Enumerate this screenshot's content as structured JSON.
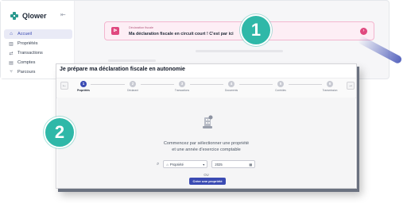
{
  "app": {
    "logo_text": "Qlower"
  },
  "sidebar": {
    "items": [
      {
        "label": "Accueil",
        "icon": "home-icon",
        "active": true
      },
      {
        "label": "Propriétés",
        "icon": "building-icon",
        "active": false
      },
      {
        "label": "Transactions",
        "icon": "transfer-icon",
        "active": false
      },
      {
        "label": "Comptes",
        "icon": "accounts-icon",
        "active": false
      },
      {
        "label": "Parcours",
        "icon": "route-icon",
        "active": false
      }
    ]
  },
  "banner": {
    "kicker": "Déclaration fiscale",
    "title": "Ma déclaration fiscale en circuit court ! C'est par ici"
  },
  "badges": {
    "one": "1",
    "two": "2"
  },
  "modal": {
    "title": "Je prépare ma déclaration fiscale en autonomie",
    "steps": [
      {
        "num": "1",
        "label": "Propriétés",
        "active": true
      },
      {
        "num": "2",
        "label": "Déclarant",
        "active": false
      },
      {
        "num": "3",
        "label": "Transactions",
        "active": false
      },
      {
        "num": "4",
        "label": "Documents",
        "active": false
      },
      {
        "num": "5",
        "label": "Contrôles",
        "active": false
      },
      {
        "num": "6",
        "label": "Transmission",
        "active": false
      }
    ],
    "empty_line1": "Commencez par sélectionner une propriété",
    "empty_line2": "et une année d'exercice comptable",
    "property_placeholder": "Propriété",
    "year_value": "2025",
    "or_label": "OU",
    "create_button": "Créer une propriété"
  },
  "colors": {
    "accent": "#3b4bb3",
    "teal": "#2fb8a8",
    "pink": "#e0487f"
  }
}
